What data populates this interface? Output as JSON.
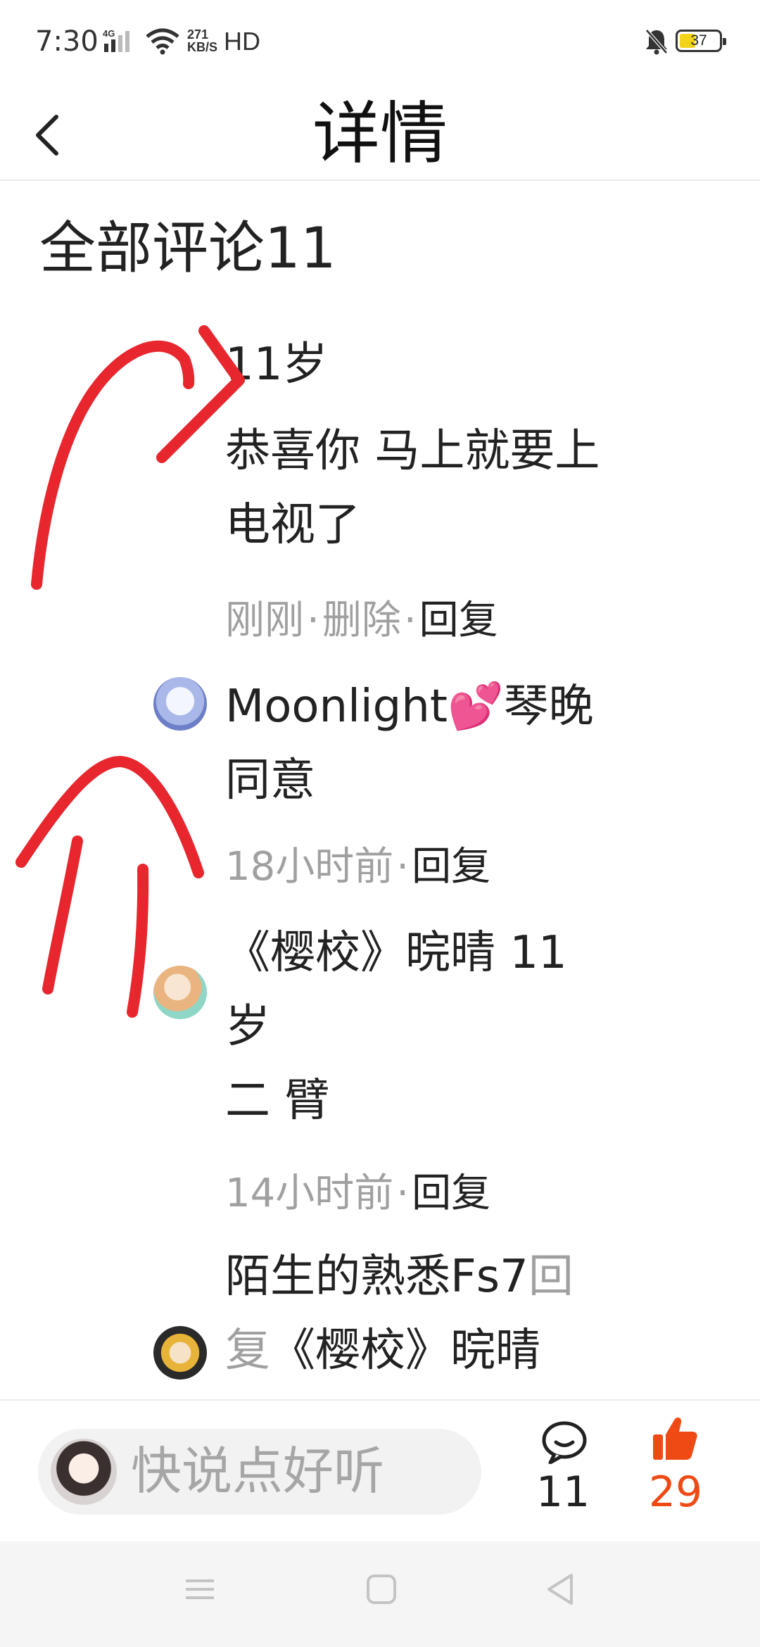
{
  "status_bar": {
    "time": "7:30",
    "network": "4G",
    "speed_value": "271",
    "speed_unit": "KB/S",
    "hd": "HD",
    "battery": "37"
  },
  "header": {
    "title": "详情"
  },
  "comments_section": {
    "title": "全部评论11",
    "comments": [
      {
        "text_line1": "11岁",
        "text_line2": "恭喜你 马上就要上",
        "text_line3": "电视了",
        "time": "刚刚",
        "delete": "删除",
        "reply": "回复"
      },
      {
        "text_line1": "Moonlight💕琴晚",
        "text_line2": "同意",
        "time": "18小时前",
        "reply": "回复"
      },
      {
        "text_line1": "《樱校》晥晴  11",
        "text_line2": "岁",
        "text_line3": "二      臂",
        "time": "14小时前",
        "reply": "回复"
      },
      {
        "author": "陌生的熟悉Fs7",
        "reply_prefix_1": "回",
        "reply_prefix_2": "复",
        "target": "《樱校》晥晴"
      }
    ]
  },
  "bottom_bar": {
    "input_placeholder": "快说点好听",
    "comment_count": "11",
    "like_count": "29",
    "like_color": "#f04a14"
  },
  "icons": [
    "back-arrow-icon",
    "comment-bubble-icon",
    "thumbs-up-icon",
    "menu-icon",
    "home-square-icon",
    "back-triangle-icon",
    "bell-muted-icon",
    "wifi-icon",
    "signal-icon"
  ]
}
